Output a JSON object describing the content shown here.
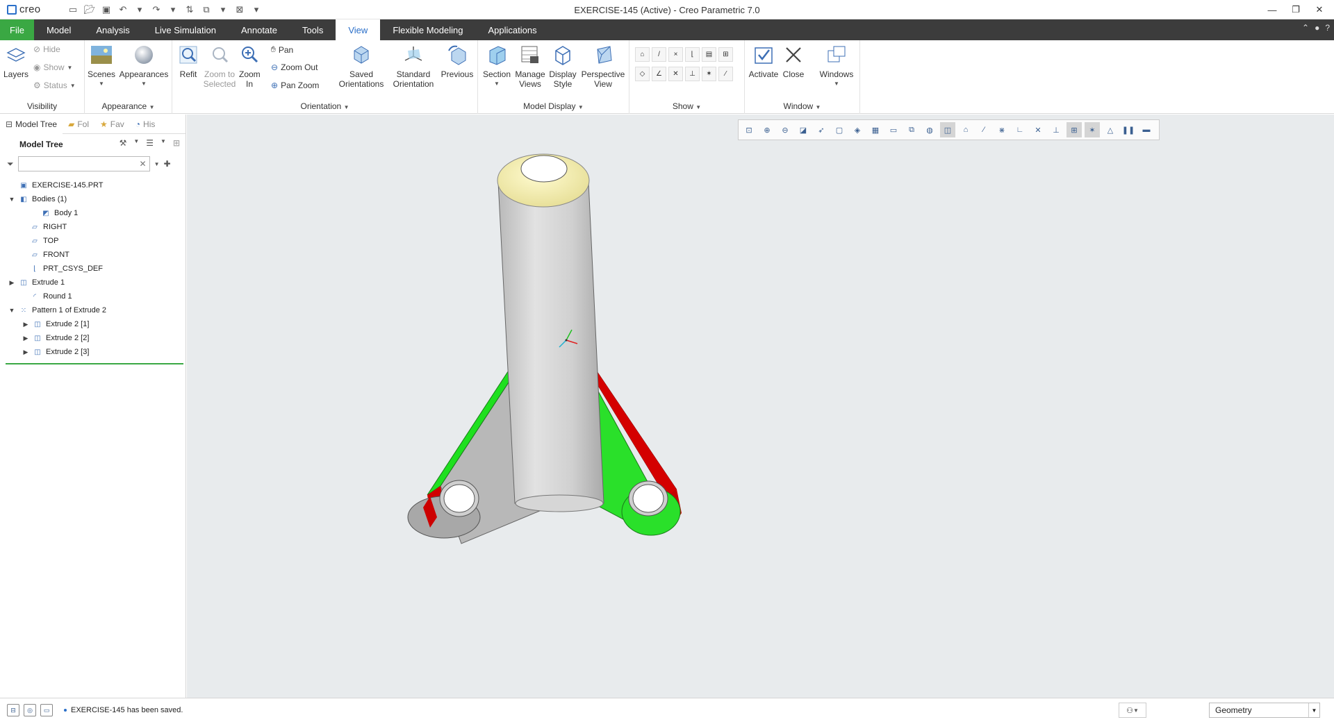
{
  "app": {
    "logo_text": "creo",
    "window_title": "EXERCISE-145 (Active) - Creo Parametric 7.0"
  },
  "tabs": [
    {
      "label": "File"
    },
    {
      "label": "Model"
    },
    {
      "label": "Analysis"
    },
    {
      "label": "Live Simulation"
    },
    {
      "label": "Annotate"
    },
    {
      "label": "Tools"
    },
    {
      "label": "View"
    },
    {
      "label": "Flexible Modeling"
    },
    {
      "label": "Applications"
    }
  ],
  "ribbon": {
    "visibility": {
      "label": "Visibility",
      "layers": "Layers",
      "hide": "Hide",
      "show": "Show",
      "status": "Status"
    },
    "appearance": {
      "label": "Appearance",
      "scenes": "Scenes",
      "appearances": "Appearances"
    },
    "orientation": {
      "label": "Orientation",
      "refit": "Refit",
      "zoom_to_selected": "Zoom to Selected",
      "zoom_in": "Zoom In",
      "pan": "Pan",
      "zoom_out": "Zoom Out",
      "pan_zoom": "Pan Zoom",
      "saved_orientations": "Saved Orientations",
      "standard_orientation": "Standard Orientation",
      "previous": "Previous"
    },
    "model_display": {
      "label": "Model Display",
      "section": "Section",
      "manage_views": "Manage Views",
      "display_style": "Display Style",
      "perspective_view": "Perspective View"
    },
    "show": {
      "label": "Show"
    },
    "window": {
      "label": "Window",
      "activate": "Activate",
      "close": "Close",
      "windows": "Windows"
    }
  },
  "panel": {
    "tabs": [
      {
        "label": "Model Tree"
      },
      {
        "label": "Fol"
      },
      {
        "label": "Fav"
      },
      {
        "label": "His"
      }
    ],
    "tree_title": "Model Tree",
    "search_placeholder": "",
    "nodes": [
      {
        "label": "EXERCISE-145.PRT",
        "expander": "",
        "icon": "part-icon"
      },
      {
        "label": "Bodies (1)",
        "expander": "▼",
        "icon": "bodies-icon"
      },
      {
        "label": "Body 1",
        "expander": "",
        "icon": "body-icon"
      },
      {
        "label": "RIGHT",
        "expander": "",
        "icon": "datum-plane-icon"
      },
      {
        "label": "TOP",
        "expander": "",
        "icon": "datum-plane-icon"
      },
      {
        "label": "FRONT",
        "expander": "",
        "icon": "datum-plane-icon"
      },
      {
        "label": "PRT_CSYS_DEF",
        "expander": "",
        "icon": "csys-icon"
      },
      {
        "label": "Extrude 1",
        "expander": "▶",
        "icon": "extrude-icon"
      },
      {
        "label": "Round 1",
        "expander": "",
        "icon": "round-icon"
      },
      {
        "label": "Pattern 1 of Extrude 2",
        "expander": "▼",
        "icon": "pattern-icon"
      },
      {
        "label": "Extrude 2 [1]",
        "expander": "▶",
        "icon": "extrude-icon"
      },
      {
        "label": "Extrude 2 [2]",
        "expander": "▶",
        "icon": "extrude-icon"
      },
      {
        "label": "Extrude 2 [3]",
        "expander": "▶",
        "icon": "extrude-icon"
      }
    ]
  },
  "status": {
    "message": "EXERCISE-145 has been saved.",
    "filter_value": "Geometry"
  },
  "colors": {
    "file_tab": "#3aa843",
    "tab_bar": "#3c3c3c",
    "active_tab_text": "#2a6fc9",
    "viewport_bg": "#e8ebed",
    "model_gray": "#c4c4c4",
    "highlight_green": "#00e000",
    "highlight_red": "#d80000",
    "cap_yellow": "#f5f1a8"
  }
}
